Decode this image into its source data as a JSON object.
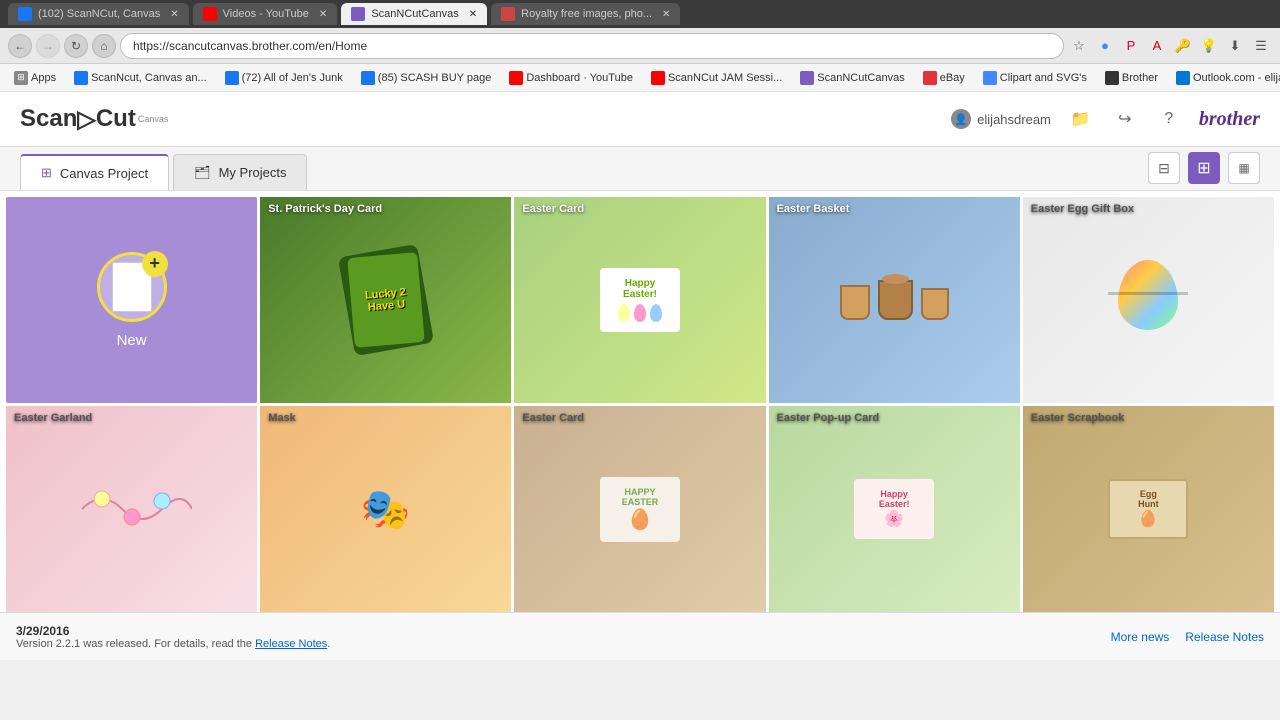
{
  "browser": {
    "tabs": [
      {
        "id": "tab1",
        "label": "(102) ScanNCut, Canvas",
        "active": false,
        "favicon_color": "#1877f2"
      },
      {
        "id": "tab2",
        "label": "Videos - YouTube",
        "active": false,
        "favicon_color": "#ff0000"
      },
      {
        "id": "tab3",
        "label": "ScanNCutCanvas",
        "active": true,
        "favicon_color": "#7c5cbf"
      },
      {
        "id": "tab4",
        "label": "Royalty free images, pho...",
        "active": false,
        "favicon_color": "#cc4444"
      }
    ],
    "url": "https://scancutcanvas.brother.com/en/Home",
    "back_btn": "←",
    "forward_btn": "→",
    "reload_btn": "↻",
    "home_btn": "⌂"
  },
  "bookmarks": [
    {
      "label": "Apps",
      "icon_color": "#888"
    },
    {
      "label": "ScanNcut, Canvas an...",
      "icon_color": "#1877f2"
    },
    {
      "label": "(72) All of Jen's Junk",
      "icon_color": "#1877f2"
    },
    {
      "label": "(85) SCASH BUY page",
      "icon_color": "#1877f2"
    },
    {
      "label": "Dashboard · YouTube",
      "icon_color": "#ff0000"
    },
    {
      "label": "ScanNCut JAM Sessi...",
      "icon_color": "#ff0000"
    },
    {
      "label": "ScanNCutCanvas",
      "icon_color": "#7c5cbf"
    },
    {
      "label": "eBay",
      "icon_color": "#e53238"
    },
    {
      "label": "Clipart and SVG's",
      "icon_color": "#4488ff"
    },
    {
      "label": "Brother",
      "icon_color": "#333"
    },
    {
      "label": "Outlook.com - elijah...",
      "icon_color": "#0078d4"
    }
  ],
  "header": {
    "logo_text": "ScanNCut",
    "logo_sub": "Canvas",
    "username": "elijahsdream",
    "icons": [
      "folder",
      "logout",
      "help"
    ]
  },
  "tabs": {
    "canvas_project_label": "Canvas Project",
    "my_projects_label": "My Projects"
  },
  "view_buttons": {
    "list_icon": "☰",
    "grid_icon": "⊞",
    "grid2_icon": "⊟"
  },
  "projects_row1": [
    {
      "id": "new",
      "label": "New",
      "type": "new"
    },
    {
      "id": "stpatrick",
      "label": "St. Patrick's Day Card",
      "bg": "stpatrick"
    },
    {
      "id": "eastercard1",
      "label": "Easter Card",
      "bg": "eastercard1"
    },
    {
      "id": "easterbasket",
      "label": "Easter Basket",
      "bg": "easterbasket"
    },
    {
      "id": "easteregg",
      "label": "Easter Egg Gift Box",
      "bg": "easteregg"
    }
  ],
  "projects_row2": [
    {
      "id": "eastergarland",
      "label": "Easter Garland",
      "bg": "eastergarland"
    },
    {
      "id": "mask",
      "label": "Mask",
      "bg": "mask"
    },
    {
      "id": "eastercard2",
      "label": "Easter Card",
      "bg": "eastercard2"
    },
    {
      "id": "easterpopup",
      "label": "Easter Pop-up Card",
      "bg": "easterpopup"
    },
    {
      "id": "easterscrap",
      "label": "Easter Scrapbook",
      "bg": "easterscrap"
    }
  ],
  "footer": {
    "date": "3/29/2016",
    "news_text": "Version 2.2.1 was released. For details, read the",
    "release_notes_link": "Release Notes",
    "period": ".",
    "more_news": "More news",
    "release_notes": "Release Notes"
  },
  "brother_logo": "brother"
}
